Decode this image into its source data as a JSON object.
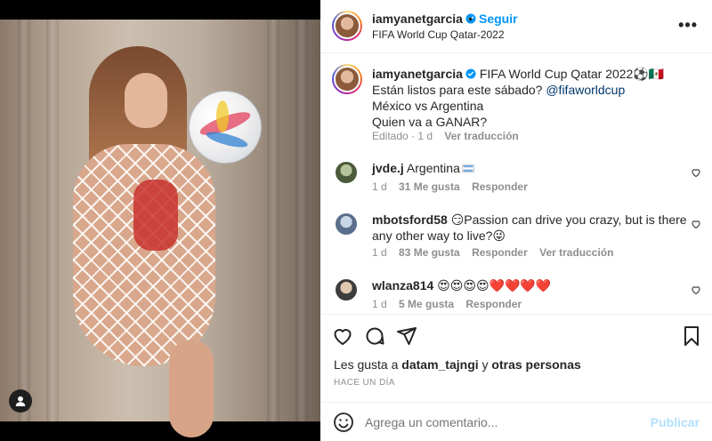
{
  "post": {
    "author": "iamyanetgarcia",
    "follow_label": "Seguir",
    "separator": "•",
    "location": "FIFA World Cup Qatar-2022",
    "more_label": "•••"
  },
  "caption": {
    "author": "iamyanetgarcia",
    "line1": "FIFA World Cup Qatar 2022⚽🇲🇽",
    "line2_text": "Están listos para este sábado? ",
    "line2_mention": "@fifaworldcup",
    "line3": "México vs Argentina",
    "line4": "Quien va a GANAR?",
    "edited": "Editado · 1 d",
    "translate": "Ver traducción"
  },
  "comments": [
    {
      "user": "jvde.j",
      "text": "Argentina",
      "time": "1 d",
      "likes": "31 Me gusta",
      "reply": "Responder"
    },
    {
      "user": "mbotsford58",
      "text": "😏Passion can drive you crazy, but is there any other way to live?😜",
      "time": "1 d",
      "likes": "83 Me gusta",
      "reply": "Responder",
      "translate": "Ver traducción"
    },
    {
      "user": "wlanza814",
      "text": "😍😍😍😍❤️❤️❤️❤️",
      "time": "1 d",
      "likes": "5 Me gusta",
      "reply": "Responder"
    }
  ],
  "likes": {
    "prefix": "Les gusta a ",
    "user": "datam_tajngi",
    "middle": " y ",
    "others": "otras personas"
  },
  "timestamp": "HACE UN DÍA",
  "composer": {
    "placeholder": "Agrega un comentario...",
    "publish": "Publicar"
  },
  "colors": {
    "link": "#0095f6",
    "publish_disabled": "#b2dffc",
    "muted": "#8e8e8e",
    "text": "#262626"
  },
  "icons": [
    "verified-badge-icon",
    "heart-icon",
    "comment-icon",
    "share-icon",
    "bookmark-icon",
    "emoji-icon",
    "user-tag-icon",
    "more-icon"
  ]
}
